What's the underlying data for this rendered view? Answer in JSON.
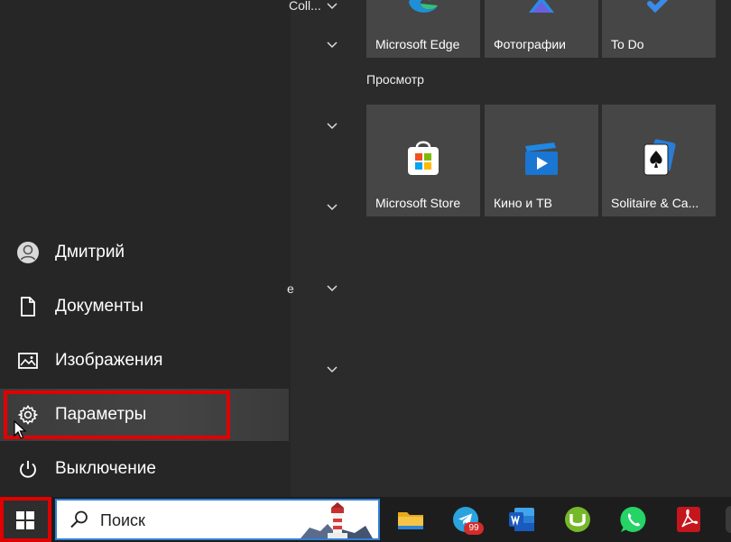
{
  "start_menu": {
    "rail": {
      "user": "Дмитрий",
      "documents": "Документы",
      "pictures": "Изображения",
      "settings": "Параметры",
      "power": "Выключение"
    },
    "app_list": {
      "fragment_top": "Coll...",
      "fragment_mid": "e"
    },
    "tiles": {
      "top_row": [
        {
          "label": "Microsoft Edge",
          "icon": "edge-icon"
        },
        {
          "label": "Фотографии",
          "icon": "photos-icon"
        },
        {
          "label": "To Do",
          "icon": "todo-icon"
        }
      ],
      "group_title": "Просмотр",
      "browse_row": [
        {
          "label": "Microsoft Store",
          "icon": "store-icon"
        },
        {
          "label": "Кино и ТВ",
          "icon": "movies-tv-icon"
        },
        {
          "label": "Solitaire & Ca...",
          "icon": "solitaire-icon"
        }
      ]
    }
  },
  "taskbar": {
    "search_placeholder": "Поиск",
    "telegram_badge": "99",
    "pinned": [
      "file-explorer-icon",
      "telegram-icon",
      "word-icon",
      "utorrent-icon",
      "whatsapp-icon",
      "acrobat-icon"
    ]
  },
  "colors": {
    "highlight": "#e00000",
    "search_border": "#2f7fd6",
    "tile_bg": "#464646"
  }
}
